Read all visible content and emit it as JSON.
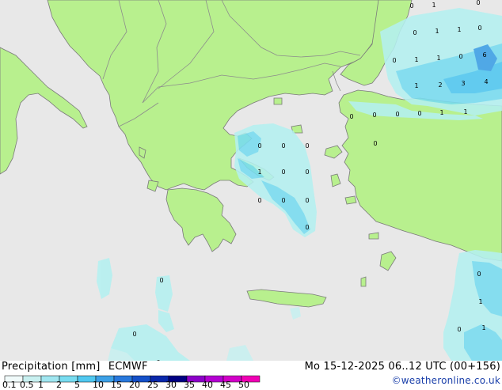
{
  "title": "Precipitation [mm]",
  "model": "ECMWF",
  "valid_time": "Mo 15-12-2025 06..12 UTC (00+156)",
  "credit": "©weatheronline.co.uk",
  "colors": {
    "sea": "#e8e8e8",
    "land": "#b8f08e",
    "coast": "#7a7a7a",
    "border": "#8c8c8c",
    "precip_light": "#b4f0f0",
    "precip_mid": "#78dcf0",
    "precip_heavy": "#3ca0e6"
  },
  "legend": {
    "labels": [
      "0.1",
      "0.5",
      "1",
      "2",
      "5",
      "10",
      "15",
      "20",
      "25",
      "30",
      "35",
      "40",
      "45",
      "50"
    ],
    "colors": [
      "#f0fafa",
      "#c8f0f0",
      "#a0e6f0",
      "#78dcf0",
      "#50c8f0",
      "#3ca0e6",
      "#2878dc",
      "#1450c8",
      "#0a28aa",
      "#000082",
      "#8c00c8",
      "#b400d2",
      "#d200c8",
      "#f000b4"
    ]
  },
  "precip_labels": [
    {
      "text": "0"
    },
    {
      "text": "1"
    },
    {
      "text": "0"
    },
    {
      "text": "0"
    },
    {
      "text": "1"
    },
    {
      "text": "1"
    },
    {
      "text": "0"
    },
    {
      "text": "0"
    },
    {
      "text": "1"
    },
    {
      "text": "1"
    },
    {
      "text": "0"
    },
    {
      "text": "6"
    },
    {
      "text": "1"
    },
    {
      "text": "2"
    },
    {
      "text": "3"
    },
    {
      "text": "4"
    },
    {
      "text": "0"
    },
    {
      "text": "0"
    },
    {
      "text": "0"
    },
    {
      "text": "0"
    },
    {
      "text": "1"
    },
    {
      "text": "1"
    },
    {
      "text": "0"
    },
    {
      "text": "0"
    },
    {
      "text": "0"
    },
    {
      "text": "0"
    },
    {
      "text": "1"
    },
    {
      "text": "0"
    },
    {
      "text": "0"
    },
    {
      "text": "0"
    },
    {
      "text": "0"
    },
    {
      "text": "0"
    },
    {
      "text": "0"
    },
    {
      "text": "0"
    },
    {
      "text": "0"
    },
    {
      "text": "0"
    },
    {
      "text": "1"
    },
    {
      "text": "0"
    },
    {
      "text": "1"
    },
    {
      "text": "0"
    }
  ]
}
